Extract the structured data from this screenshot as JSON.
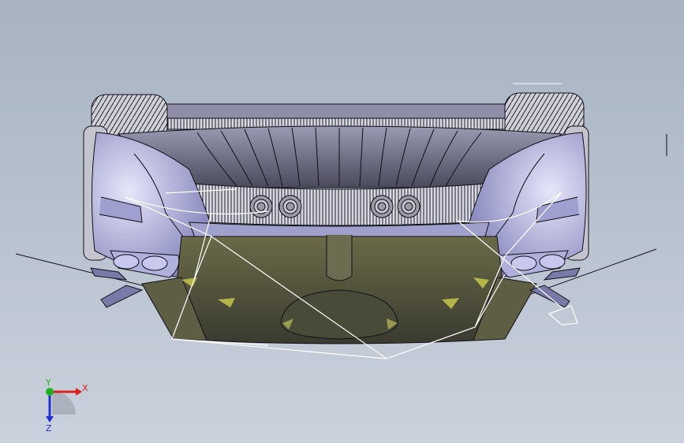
{
  "viewport": {
    "background_top": "#a7b3c1",
    "background_bottom": "#c9d1dc"
  },
  "triad": {
    "x_label": "X",
    "y_label": "Y",
    "z_label": "Z",
    "x_color": "#e02020",
    "y_color": "#20b020",
    "z_color": "#2030d0"
  },
  "model": {
    "body_color": "#8f8fc8",
    "body_light": "#c8c8ec",
    "body_dark": "#3c3c50",
    "underside_color": "#5a5a3c",
    "tire_color": "#c8c8d0",
    "edge_color": "#101018",
    "sketch_color": "#ffffff"
  }
}
